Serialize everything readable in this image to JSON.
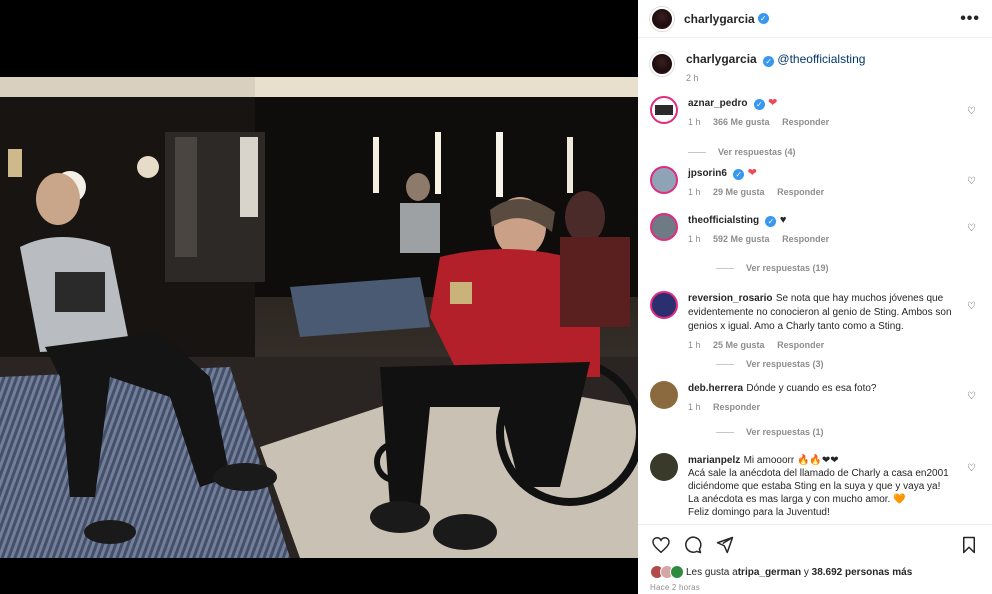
{
  "post": {
    "author": "charlygarcia",
    "more_label": "•••"
  },
  "caption": {
    "author": "charlygarcia",
    "mention": "@theofficialsting",
    "time": "2 h"
  },
  "comments": [
    {
      "user": "aznar_pedro",
      "verified": true,
      "text": "❤",
      "time": "1 h",
      "likes": "366 Me gusta",
      "reply": "Responder",
      "replies": "Ver respuestas (4)",
      "avatar_color": "#d7c7b7"
    },
    {
      "user": "jpsorin6",
      "verified": true,
      "text": "❤",
      "time": "1 h",
      "likes": "29 Me gusta",
      "reply": "Responder",
      "avatar_color": "#8fa3b6"
    },
    {
      "user": "theofficialsting",
      "verified": true,
      "text": "♥",
      "time": "1 h",
      "likes": "592 Me gusta",
      "reply": "Responder",
      "replies": "Ver respuestas (19)",
      "avatar_color": "#6f7b84"
    },
    {
      "user": "reversion_rosario",
      "verified": false,
      "text": "Se nota que hay muchos jóvenes que evidentemente no conocieron al genio de Sting. Ambos son genios x igual. Amo a Charly tanto como a Sting.",
      "time": "1 h",
      "likes": "25 Me gusta",
      "reply": "Responder",
      "replies": "Ver respuestas (3)",
      "avatar_color": "#2b2f6f"
    },
    {
      "user": "deb.herrera",
      "verified": false,
      "text": "Dónde y cuando es esa foto?",
      "time": "1 h",
      "reply": "Responder",
      "replies": "Ver respuestas (1)",
      "avatar_color": "#8b6a3f"
    },
    {
      "user": "marianpelz",
      "verified": false,
      "text": "Mi amooorr 🔥🔥❤❤",
      "text2": "Acá sale la anécdota del llamado de Charly a casa en2001 diciéndome que estaba Sting en la suya y que y vaya ya!",
      "text3": "La anécdota es mas larga y con mucho amor. 🧡",
      "text4": "Feliz domingo para la Juventud!",
      "avatar_color": "#3a3a2a"
    }
  ],
  "likes": {
    "prefix": "Les gusta a ",
    "user": "tripa_german",
    "middle": " y ",
    "count": "38.692 personas más"
  },
  "posted_ago": "Hace 2 horas",
  "colors": {
    "verified": "#3897f0",
    "heart": "#ed4956",
    "secondary_text": "#8e8e8e"
  }
}
